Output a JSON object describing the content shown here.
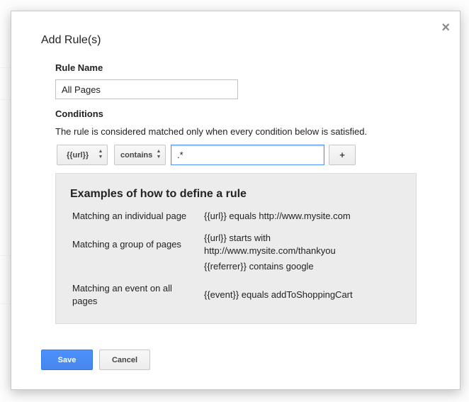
{
  "dialog": {
    "title": "Add Rule(s)",
    "close_symbol": "×",
    "rule_name_label": "Rule Name",
    "rule_name_value": "All Pages",
    "conditions_label": "Conditions",
    "conditions_description": "The rule is considered matched only when every condition below is satisfied.",
    "condition": {
      "variable": "{{url}}",
      "operator": "contains",
      "value": ".*",
      "add_label": "+"
    },
    "examples": {
      "title": "Examples of how to define a rule",
      "rows": [
        {
          "label": "Matching an individual page",
          "values": [
            "{{url}} equals http://www.mysite.com"
          ]
        },
        {
          "label": "Matching a group of pages",
          "values": [
            "{{url}} starts with http://www.mysite.com/thankyou",
            "{{referrer}} contains google"
          ]
        },
        {
          "label": "Matching an event on all pages",
          "values": [
            "{{event}} equals addToShoppingCart"
          ]
        }
      ]
    },
    "save_label": "Save",
    "cancel_label": "Cancel"
  },
  "colors": {
    "primary_button": "#4d90fe",
    "focus_border": "#4d90fe",
    "examples_background": "#ececec"
  },
  "icons": {
    "close": "close-icon",
    "select_arrows": "updown-arrows-icon"
  }
}
